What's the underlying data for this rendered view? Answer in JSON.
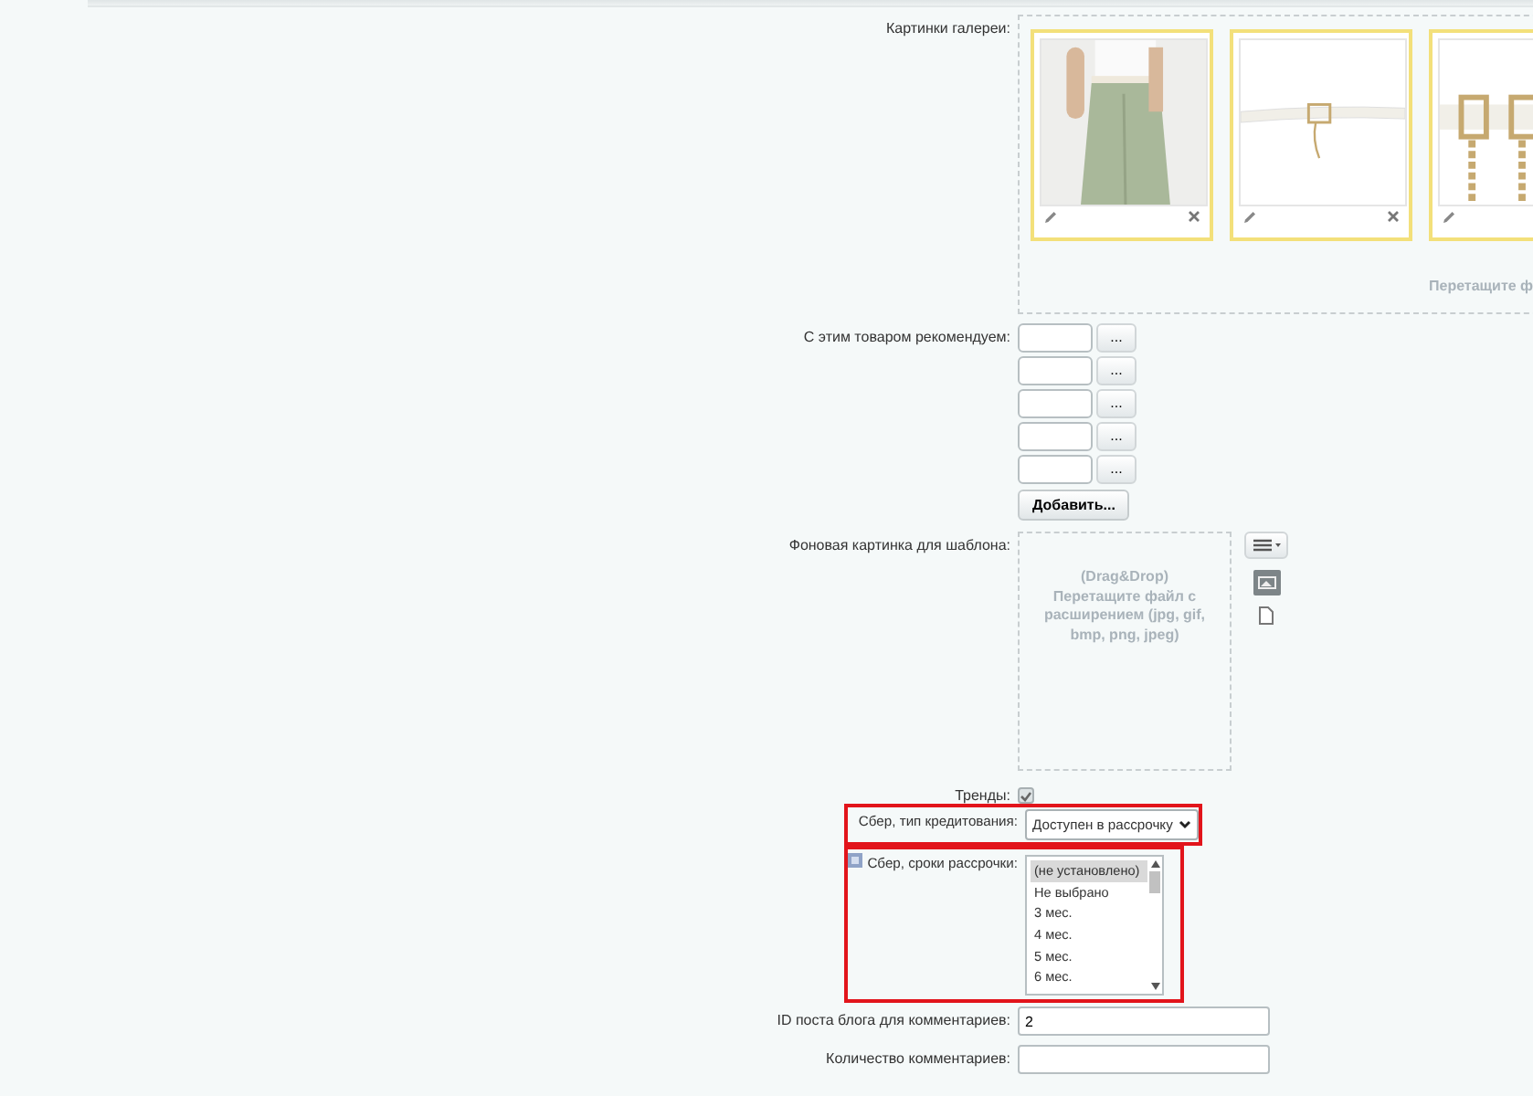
{
  "gallery": {
    "label": "Картинки галереи:",
    "images": [
      {
        "kind": "picture",
        "removable": true
      },
      {
        "kind": "picture",
        "removable": true
      },
      {
        "kind": "picture"
      }
    ],
    "drop_hint": "Перетащите ф"
  },
  "recommend": {
    "label": "С этим товаром рекомендуем:",
    "items": [
      {
        "button": "..."
      },
      {
        "button": "..."
      },
      {
        "button": "..."
      },
      {
        "button": "..."
      },
      {
        "button": "..."
      }
    ],
    "add_button": "Добавить..."
  },
  "background": {
    "label": "Фоновая картинка для шаблона:",
    "drop_title": "(Drag&Drop)",
    "drop_text": "Перетащите файл с расширением (jpg, gif, bmp, png, jpeg)"
  },
  "trends": {
    "label": "Тренды:",
    "checked": true
  },
  "credit_type": {
    "label": "Сбер, тип кредитования:",
    "value": "Доступен в рассрочку",
    "highlighted": true
  },
  "terms": {
    "label": "Сбер, сроки рассрочки:",
    "highlighted": true,
    "options": [
      {
        "text": "(не установлено)",
        "selected": true
      },
      {
        "text": "Не выбрано",
        "selected": false
      },
      {
        "text": "3 мес.",
        "selected": false
      },
      {
        "text": "4 мес.",
        "selected": false
      },
      {
        "text": "5 мес.",
        "selected": false
      },
      {
        "text": "6 мес.",
        "selected": false
      }
    ]
  },
  "blog_id": {
    "label": "ID поста блога для комментариев:",
    "value": "2"
  },
  "comments_count": {
    "label": "Количество комментариев:"
  }
}
